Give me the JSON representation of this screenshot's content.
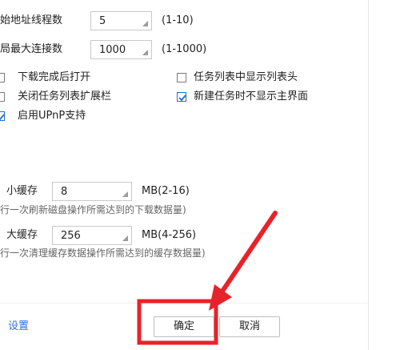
{
  "settings": {
    "original_threads": {
      "label": "始地址线程数",
      "value": "5",
      "range": "(1-10)"
    },
    "max_connections": {
      "label": "局最大连接数",
      "value": "1000",
      "range": "(1-1000)"
    }
  },
  "checkboxes": {
    "open_after_download": {
      "label": "下载完成后打开",
      "checked": false
    },
    "show_list_header": {
      "label": "任务列表中显示列表头",
      "checked": false
    },
    "close_expand_bar": {
      "label": "关闭任务列表扩展栏",
      "checked": false
    },
    "hide_main_on_new": {
      "label": "新建任务时不显示主界面",
      "checked": true
    },
    "enable_upnp": {
      "label": "启用UPnP支持",
      "checked": true
    }
  },
  "cache": {
    "min": {
      "label": "小缓存",
      "value": "8",
      "unit": "MB(2-16)",
      "hint": "行一次刷新磁盘操作所需达到的下载数据量)"
    },
    "max": {
      "label": "大缓存",
      "value": "256",
      "unit": "MB(4-256)",
      "hint": "行一次清理缓存数据操作所需达到的缓存数据量)"
    }
  },
  "footer": {
    "settings_link": "设置",
    "ok_label": "确定",
    "cancel_label": "取消"
  },
  "colors": {
    "accent": "#1e6fd0",
    "annotation_red": "#e8222a",
    "link": "#2a6fd6"
  }
}
